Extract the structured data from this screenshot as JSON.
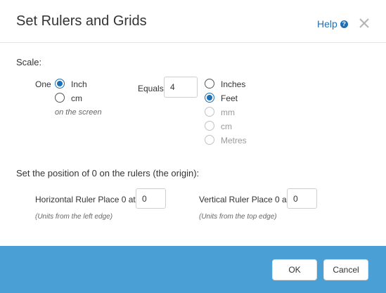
{
  "dialog": {
    "title": "Set Rulers and Grids",
    "help_label": "Help"
  },
  "scale": {
    "section_label": "Scale:",
    "one_label": "One",
    "one_units": [
      {
        "label": "Inch",
        "checked": true
      },
      {
        "label": "cm",
        "checked": false
      }
    ],
    "on_screen_hint": "on the screen",
    "equals_label": "Equals",
    "equals_value": "4",
    "equals_units": [
      {
        "label": "Inches",
        "checked": false,
        "disabled": false
      },
      {
        "label": "Feet",
        "checked": true,
        "disabled": false
      },
      {
        "label": "mm",
        "checked": false,
        "disabled": true
      },
      {
        "label": "cm",
        "checked": false,
        "disabled": true
      },
      {
        "label": "Metres",
        "checked": false,
        "disabled": true
      }
    ]
  },
  "origin": {
    "section_label": "Set the position of 0 on the rulers (the origin):",
    "horizontal": {
      "label": "Horizontal Ruler Place 0 at",
      "value": "0",
      "hint": "(Units from the left edge)"
    },
    "vertical": {
      "label": "Vertical Ruler Place 0 at",
      "value": "0",
      "hint": "(Units from the top edge)"
    }
  },
  "footer": {
    "ok_label": "OK",
    "cancel_label": "Cancel"
  },
  "colors": {
    "accent": "#1f6fb5",
    "footer_bg": "#4a9fd4"
  }
}
